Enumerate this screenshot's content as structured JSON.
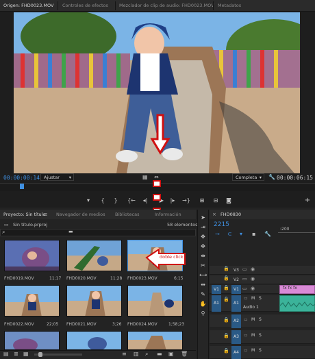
{
  "tabs": [
    {
      "label": "Origen: FHD0023.MOV"
    },
    {
      "label": "Controles de efectos"
    },
    {
      "label": "Mezclador de clip de audio: FHD0023.MOV"
    },
    {
      "label": "Metadatos"
    }
  ],
  "source": {
    "timecode_in": "00:00:00:14",
    "fit": "Ajustar",
    "quality": "Completa",
    "timecode_dur": "00:00:06:15"
  },
  "project": {
    "tabs": [
      {
        "label": "Proyecto: Sin título"
      },
      {
        "label": "Navegador de medios"
      },
      {
        "label": "Bibliotecas"
      },
      {
        "label": "Información"
      }
    ],
    "file": "Sin título.prproj",
    "count": "58 elementos",
    "clips": [
      {
        "name": "FHD0019.MOV",
        "dur": "11;17"
      },
      {
        "name": "FHD0020.MOV",
        "dur": "11;28"
      },
      {
        "name": "FHD0023.MOV",
        "dur": "6;15"
      },
      {
        "name": "FHD0022.MOV",
        "dur": "22;05"
      },
      {
        "name": "FHD0021.MOV",
        "dur": "3;26"
      },
      {
        "name": "FHD0024.MOV",
        "dur": "1;58;23"
      }
    ]
  },
  "annotation": "doble click",
  "timeline": {
    "tab": "FHD0830",
    "timecode": "2215",
    "ruler": ":200",
    "tracks": {
      "v3": "V3",
      "v2": "V2",
      "v1_src": "V1",
      "v1": "V1",
      "a1_src": "A1",
      "a1": "A1",
      "audio1": "Audio 1",
      "a2": "A2",
      "a3": "A3",
      "a4": "A4",
      "m": "M",
      "s": "S"
    }
  },
  "colors": {
    "accent": "#3f8fe0",
    "video_clip": "#d98ad6",
    "audio_clip": "#3bb39a",
    "arrow": "#d01010"
  }
}
